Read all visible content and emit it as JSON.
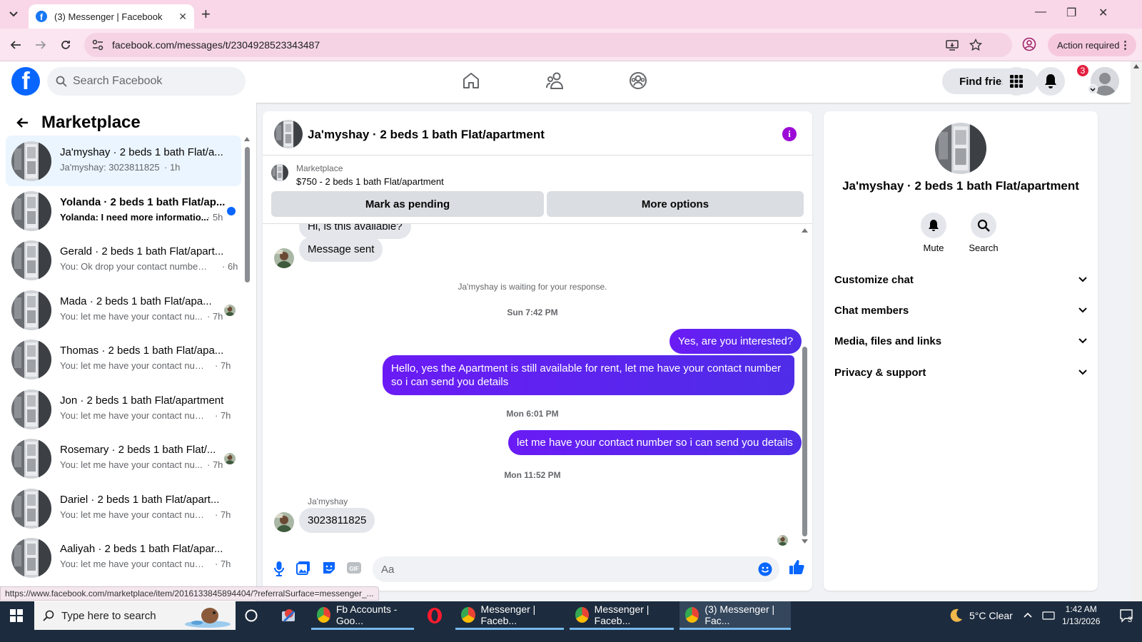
{
  "browser": {
    "tab_title": "(3) Messenger | Facebook",
    "url": "facebook.com/messages/t/2304928523343487",
    "action_required": "Action required",
    "status_url": "https://www.facebook.com/marketplace/item/2016133845894404/?referralSurface=messenger_..."
  },
  "fb_header": {
    "search_placeholder": "Search Facebook",
    "find_friends": "Find friends",
    "notification_count": "3"
  },
  "left_panel": {
    "back_label": "Marketplace",
    "conversations": [
      {
        "name": "Ja'myshay · 2 beds 1 bath Flat/a...",
        "preview": "Ja'myshay: 3023811825",
        "time": "· 1h",
        "active": true
      },
      {
        "name": "Yolanda · 2 beds 1 bath Flat/ap...",
        "preview": "Yolanda: I need more informatio...",
        "time": "· 5h",
        "unread": true
      },
      {
        "name": "Gerald · 2 beds 1 bath Flat/apart...",
        "preview": "You: Ok drop your contact number ...",
        "time": "· 6h"
      },
      {
        "name": "Mada · 2 beds 1 bath Flat/apa...",
        "preview": "You: let me have your contact nu...",
        "time": "· 7h"
      },
      {
        "name": "Thomas · 2 beds 1 bath Flat/apa...",
        "preview": "You: let me have your contact num...",
        "time": "· 7h"
      },
      {
        "name": "Jon · 2 beds 1 bath Flat/apartment",
        "preview": "You: let me have your contact num...",
        "time": "· 7h"
      },
      {
        "name": "Rosemary · 2 beds 1 bath Flat/...",
        "preview": "You: let me have your contact nu...",
        "time": "· 7h"
      },
      {
        "name": "Dariel · 2 beds 1 bath Flat/apart...",
        "preview": "You: let me have your contact num...",
        "time": "· 7h"
      },
      {
        "name": "Aaliyah · 2 beds 1 bath Flat/apar...",
        "preview": "You: let me have your contact num...",
        "time": "· 7h"
      }
    ]
  },
  "chat": {
    "title": "Ja'myshay · 2 beds 1 bath Flat/apartment",
    "marketplace_label": "Marketplace",
    "listing": "$750 - 2 beds 1 bath Flat/apartment",
    "mark_pending": "Mark as pending",
    "more_options": "More options",
    "partial_msg": "Hi, is this available?",
    "msg_sent": "Message sent",
    "waiting": "Ja'myshay is waiting for your response.",
    "ts1": "Sun 7:42 PM",
    "out1": "Yes, are you interested?",
    "out2": "Hello, yes the Apartment is still available for rent, let me have your contact number so i can send you details",
    "ts2": "Mon 6:01 PM",
    "out3": "let me have your contact number so i can send you details",
    "ts3": "Mon 11:52 PM",
    "sender": "Ja'myshay",
    "in_last": "3023811825",
    "composer_placeholder": "Aa"
  },
  "info_panel": {
    "name": "Ja'myshay · 2 beds 1 bath Flat/apartment",
    "mute": "Mute",
    "search": "Search",
    "rows": [
      "Customize chat",
      "Chat members",
      "Media, files and links",
      "Privacy & support"
    ]
  },
  "taskbar": {
    "search_placeholder": "Type here to search",
    "apps": [
      "Fb Accounts - Goo...",
      "Messenger | Faceb...",
      "Messenger | Faceb...",
      "(3) Messenger | Fac..."
    ],
    "weather": "5°C  Clear",
    "time": "1:42 AM",
    "date": "1/13/2026",
    "notif_count": "3"
  },
  "colors": {
    "fb_blue": "#0866ff",
    "outgoing_bubble": "#6a1bf5",
    "tab_strip": "#f9d6e8"
  }
}
